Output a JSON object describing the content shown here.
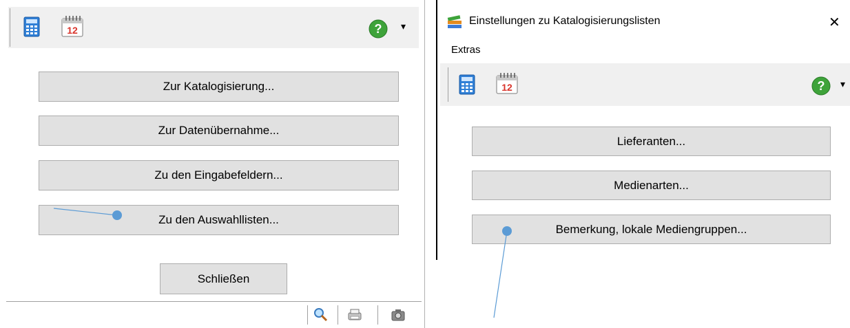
{
  "left_panel": {
    "buttons": {
      "katalogisierung": "Zur Katalogisierung...",
      "datenuebernahme": "Zur Datenübernahme...",
      "eingabefelder": "Zu den Eingabefeldern...",
      "auswahllisten": "Zu den Auswahllisten...",
      "schliessen": "Schließen"
    }
  },
  "right_panel": {
    "title": "Einstellungen zu Katalogisierungslisten",
    "close_glyph": "✕",
    "menu": {
      "extras": "Extras"
    },
    "buttons": {
      "lieferanten": "Lieferanten...",
      "medienarten": "Medienarten...",
      "bemerkung": "Bemerkung, lokale Mediengruppen..."
    }
  },
  "icons": {
    "calendar_day": "12",
    "help_glyph": "?",
    "dropdown_glyph": "▾"
  },
  "colors": {
    "accent_dot": "#5b9bd5",
    "help_green": "#3ea33a",
    "calendar_red": "#d9342b"
  }
}
